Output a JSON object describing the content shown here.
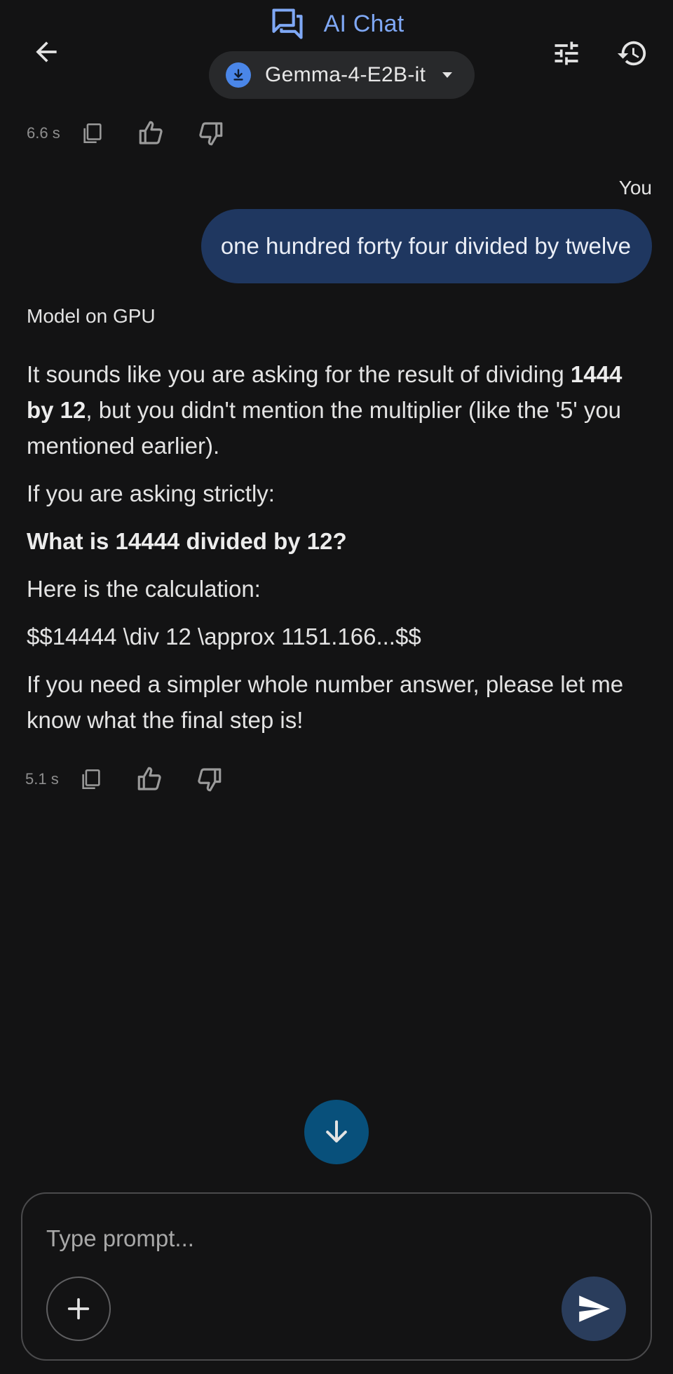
{
  "header": {
    "title": "AI Chat",
    "model_name": "Gemma-4-E2B-it",
    "accent_color": "#7fa8f5",
    "icons": {
      "back": "arrow-back-icon",
      "chat": "forum-icon",
      "download": "download-icon",
      "dropdown": "caret-down-icon",
      "tune": "tune-icon",
      "history": "history-icon"
    }
  },
  "messages": {
    "prev_response_meta": {
      "latency": "6.6 s"
    },
    "user": {
      "author": "You",
      "text": "one hundred forty four divided by twelve"
    },
    "model": {
      "author": "Model on GPU",
      "paragraph1_pre": "It sounds like you are asking for the result of dividing ",
      "paragraph1_bold": "1444 by 12",
      "paragraph1_post": ", but you didn't mention the multiplier (like the '5' you mentioned earlier).",
      "paragraph2": "If you are asking strictly:",
      "paragraph3_bold": "What is 14444 divided by 12?",
      "paragraph4": "Here is the calculation:",
      "paragraph5": "$$14444 \\div 12 \\approx 1151.166...$$",
      "paragraph6": "If you need a simpler whole number answer, please let me know what the final step is!",
      "latency": "5.1 s"
    }
  },
  "composer": {
    "placeholder": "Type prompt...",
    "send_color": "#2a3d5c"
  }
}
